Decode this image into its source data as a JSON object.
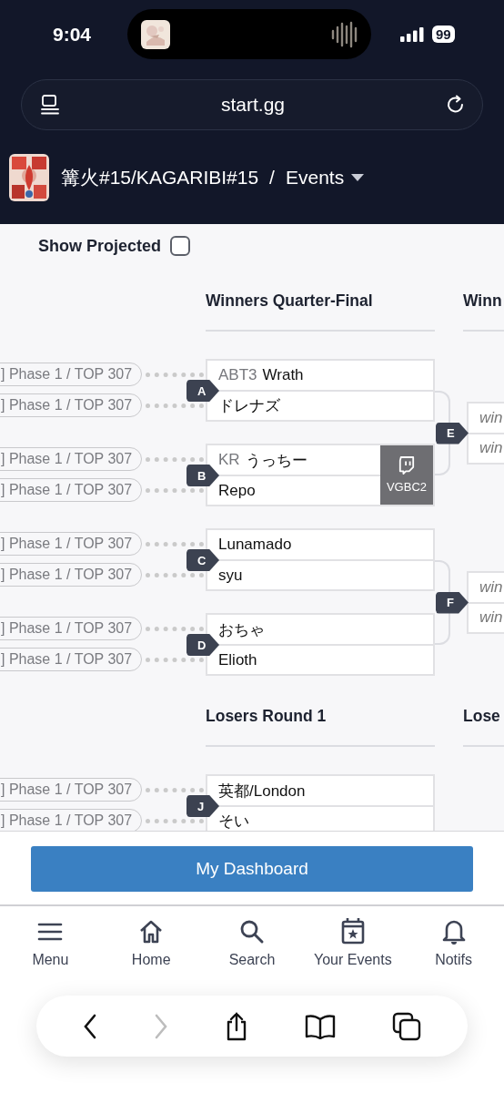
{
  "status_bar": {
    "time": "9:04",
    "battery": "99"
  },
  "address_bar": {
    "url": "start.gg"
  },
  "breadcrumb": {
    "tournament": "篝火#15/KAGARIBI#15",
    "separator": "/",
    "page": "Events"
  },
  "show_projected": {
    "label": "Show Projected",
    "checked": false
  },
  "sections": [
    {
      "rounds": [
        {
          "title": "Winners Quarter-Final",
          "matches": [
            {
              "id": "A",
              "players": [
                {
                  "kind": "entrant",
                  "prefix": "ABT3",
                  "name": "Wrath",
                  "seed": "] Phase 1 / TOP 307"
                },
                {
                  "kind": "entrant",
                  "name": "ドレナズ",
                  "seed": "] Phase 1 / TOP 307"
                }
              ]
            },
            {
              "id": "B",
              "stream": "VGBC2",
              "players": [
                {
                  "kind": "entrant",
                  "prefix": "KR",
                  "name": "うっちー",
                  "seed": "] Phase 1 / TOP 307"
                },
                {
                  "kind": "entrant",
                  "name": "Repo",
                  "seed": "] Phase 1 / TOP 307"
                }
              ]
            },
            {
              "id": "C",
              "players": [
                {
                  "kind": "entrant",
                  "name": "Lunamado",
                  "seed": "] Phase 1 / TOP 307"
                },
                {
                  "kind": "entrant",
                  "name": "syu",
                  "seed": "] Phase 1 / TOP 307"
                }
              ]
            },
            {
              "id": "D",
              "players": [
                {
                  "kind": "entrant",
                  "name": "おちゃ",
                  "seed": "] Phase 1 / TOP 307"
                },
                {
                  "kind": "entrant",
                  "name": "Elioth",
                  "seed": "] Phase 1 / TOP 307"
                }
              ]
            }
          ]
        },
        {
          "title": "Winn",
          "matches": [
            {
              "id": "E",
              "players": [
                {
                  "kind": "pending",
                  "name": "win"
                },
                {
                  "kind": "pending",
                  "name": "win"
                }
              ]
            },
            {
              "id": "F",
              "players": [
                {
                  "kind": "pending",
                  "name": "win"
                },
                {
                  "kind": "pending",
                  "name": "win"
                }
              ]
            }
          ]
        }
      ]
    },
    {
      "rounds": [
        {
          "title": "Losers Round 1",
          "matches": [
            {
              "id": "J",
              "players": [
                {
                  "kind": "entrant",
                  "name": "英都/London",
                  "seed": "] Phase 1 / TOP 307"
                },
                {
                  "kind": "entrant",
                  "name": "そい",
                  "seed": "] Phase 1 / TOP 307"
                }
              ]
            }
          ]
        },
        {
          "title": "Lose"
        }
      ]
    }
  ],
  "dashboard_button": "My Dashboard",
  "nav": [
    {
      "kind": "menu",
      "label": "Menu"
    },
    {
      "kind": "home",
      "label": "Home"
    },
    {
      "kind": "search",
      "label": "Search"
    },
    {
      "kind": "events",
      "label": "Your Events"
    },
    {
      "kind": "notifs",
      "label": "Notifs"
    }
  ],
  "browser_toolbar": [
    {
      "kind": "back",
      "disabled": false
    },
    {
      "kind": "forward",
      "disabled": true
    },
    {
      "kind": "share",
      "disabled": false
    },
    {
      "kind": "bookmarks",
      "disabled": false
    },
    {
      "kind": "tabs",
      "disabled": false
    }
  ]
}
